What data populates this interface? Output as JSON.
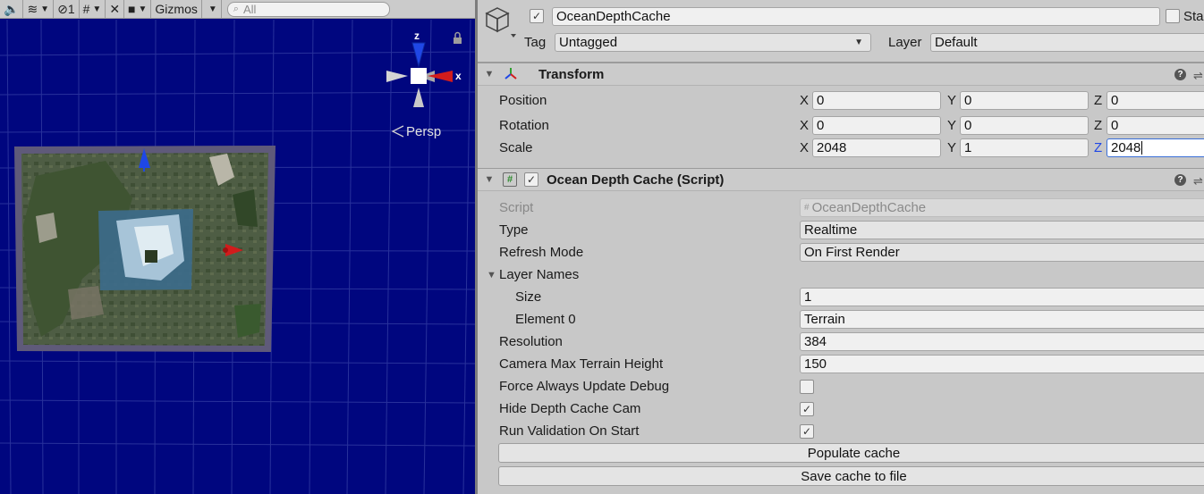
{
  "scene_toolbar": {
    "hidden_count": "1",
    "gizmos_label": "Gizmos",
    "search_placeholder": "All"
  },
  "scene_view": {
    "gizmo_axes": {
      "z": "z",
      "x": "x"
    },
    "projection_label": "Persp"
  },
  "header": {
    "object_name": "OceanDepthCache",
    "active": true,
    "static_label": "Sta",
    "tag_label": "Tag",
    "tag_value": "Untagged",
    "layer_label": "Layer",
    "layer_value": "Default"
  },
  "transform": {
    "title": "Transform",
    "position": {
      "label": "Position",
      "x": "0",
      "y": "0",
      "z": "0"
    },
    "rotation": {
      "label": "Rotation",
      "x": "0",
      "y": "0",
      "z": "0"
    },
    "scale": {
      "label": "Scale",
      "x": "2048",
      "y": "1",
      "z": "2048"
    },
    "axis_x": "X",
    "axis_y": "Y",
    "axis_z": "Z"
  },
  "script_component": {
    "title": "Ocean Depth Cache (Script)",
    "enabled": true,
    "fields": {
      "script": {
        "label": "Script",
        "value": "OceanDepthCache"
      },
      "type": {
        "label": "Type",
        "value": "Realtime"
      },
      "refresh_mode": {
        "label": "Refresh Mode",
        "value": "On First Render"
      },
      "layer_names": {
        "label": "Layer Names"
      },
      "size": {
        "label": "Size",
        "value": "1"
      },
      "element0": {
        "label": "Element 0",
        "value": "Terrain"
      },
      "resolution": {
        "label": "Resolution",
        "value": "384"
      },
      "camera_max_terrain_height": {
        "label": "Camera Max Terrain Height",
        "value": "150"
      },
      "force_always_update_debug": {
        "label": "Force Always Update Debug",
        "checked": false
      },
      "hide_depth_cache_cam": {
        "label": "Hide Depth Cache Cam",
        "checked": true
      },
      "run_validation_on_start": {
        "label": "Run Validation On Start",
        "checked": true
      }
    },
    "populate_button": "Populate cache",
    "save_button": "Save cache to file"
  },
  "colors": {
    "scene_background": "#00067f",
    "inspector_background": "#c8c8c8",
    "axis_x": "#d11c1c",
    "axis_y": "#2d2d2d",
    "axis_z": "#1f47e6",
    "active_z_label": "#1f47e6"
  }
}
